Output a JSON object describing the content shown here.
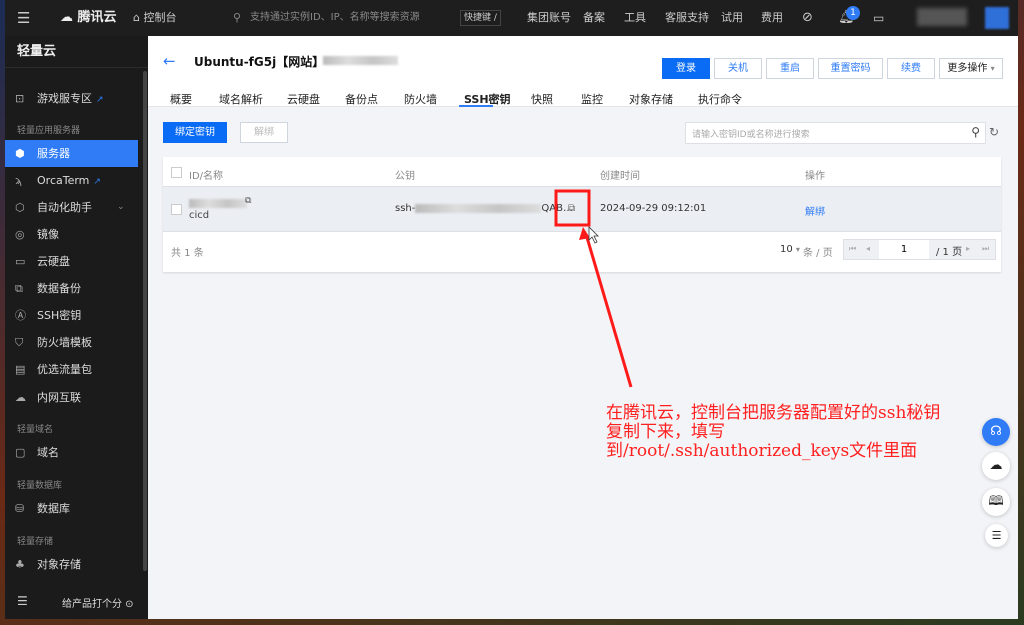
{
  "topbar": {
    "brand": "腾讯云",
    "console": "控制台",
    "search_placeholder": "支持通过实例ID、IP、名称等搜索资源",
    "shortcut": "快捷键 /",
    "nav": [
      "集团账号",
      "备案",
      "工具",
      "客服支持",
      "试用",
      "费用"
    ],
    "notification_count": "1"
  },
  "sidebar": {
    "title": "轻量云",
    "groups": [
      "轻量应用服务器",
      "轻量域名",
      "轻量数据库",
      "轻量存储"
    ],
    "items": [
      {
        "label": "游戏服专区",
        "icon": "gamepad-icon"
      },
      {
        "label": "服务器",
        "icon": "server-icon"
      },
      {
        "label": "OrcaTerm",
        "icon": "terminal-icon"
      },
      {
        "label": "自动化助手",
        "icon": "automation-icon"
      },
      {
        "label": "镜像",
        "icon": "image-icon"
      },
      {
        "label": "云硬盘",
        "icon": "disk-icon"
      },
      {
        "label": "数据备份",
        "icon": "backup-icon"
      },
      {
        "label": "SSH密钥",
        "icon": "key-icon"
      },
      {
        "label": "防火墙模板",
        "icon": "shield-icon"
      },
      {
        "label": "优选流量包",
        "icon": "traffic-icon"
      },
      {
        "label": "内网互联",
        "icon": "network-icon"
      },
      {
        "label": "域名",
        "icon": "domain-icon"
      },
      {
        "label": "数据库",
        "icon": "database-icon"
      },
      {
        "label": "对象存储",
        "icon": "storage-icon"
      }
    ],
    "rate": "给产品打个分"
  },
  "header": {
    "title": "Ubuntu-fG5j【网站】",
    "buttons": [
      "登录",
      "关机",
      "重启",
      "重置密码",
      "续费",
      "更多操作"
    ],
    "tabs": [
      "概要",
      "域名解析",
      "云硬盘",
      "备份点",
      "防火墙",
      "SSH密钥",
      "快照",
      "监控",
      "对象存储",
      "执行命令"
    ],
    "active_tab": "SSH密钥"
  },
  "toolbar": {
    "bind": "绑定密钥",
    "unbind": "解绑",
    "search_placeholder": "请输入密钥ID或名称进行搜索"
  },
  "table": {
    "columns": [
      "ID/名称",
      "公钥",
      "创建时间",
      "操作"
    ],
    "rows": [
      {
        "name": "cicd",
        "key_prefix": "ssh-",
        "key_suffix": "QAB…",
        "created": "2024-09-29 09:12:01",
        "action": "解绑"
      }
    ],
    "total": "共 1 条",
    "page_size": "10",
    "per_page": "条 / 页",
    "page": "1",
    "pages": "/ 1 页"
  },
  "annotation": {
    "text": "在腾讯云，控制台把服务器配置好的ssh秘钥\n复制下来，填写\n到/root/.ssh/authorized_keys文件里面",
    "color": "#ff2020"
  },
  "colors": {
    "accent": "#0a6cf5",
    "sidebar_active": "#2f7cf6"
  }
}
